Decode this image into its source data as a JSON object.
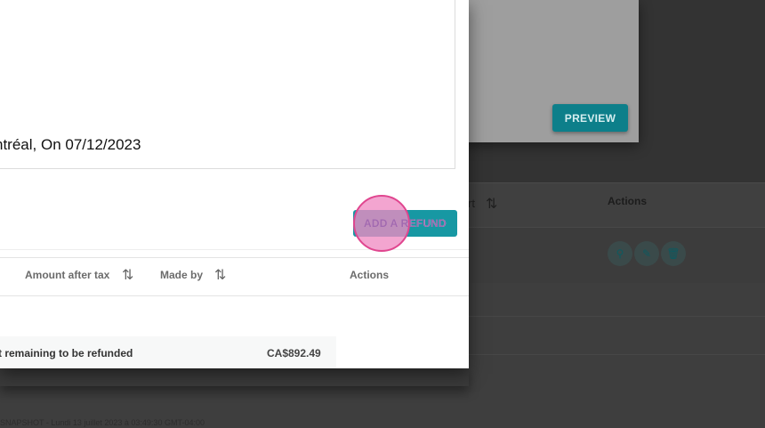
{
  "background": {
    "sort_column_fragment": "rt",
    "actions_label": "Actions",
    "row_icons": [
      "search-icon",
      "edit-icon",
      "trash-icon"
    ],
    "footer_text": "SNAPSHOT - Lundi 13 juillet 2023 à 03:49:30 GMT-04:00"
  },
  "preview": {
    "button_label": "PREVIEW"
  },
  "dialog": {
    "signature_text": "ntréal, On 07/12/2023",
    "add_refund_label": "ADD A REFUND",
    "table": {
      "columns": [
        {
          "label": "Amount after tax",
          "sortable": true
        },
        {
          "label": "Made by",
          "sortable": true
        },
        {
          "label": "Actions",
          "sortable": false
        }
      ],
      "total_label": "t remaining to be refunded",
      "total_value": "CA$892.49"
    }
  },
  "colors": {
    "accent": "#1798a3",
    "click_marker": "#e0468f"
  },
  "glyphs": {
    "sort": "⇅"
  }
}
